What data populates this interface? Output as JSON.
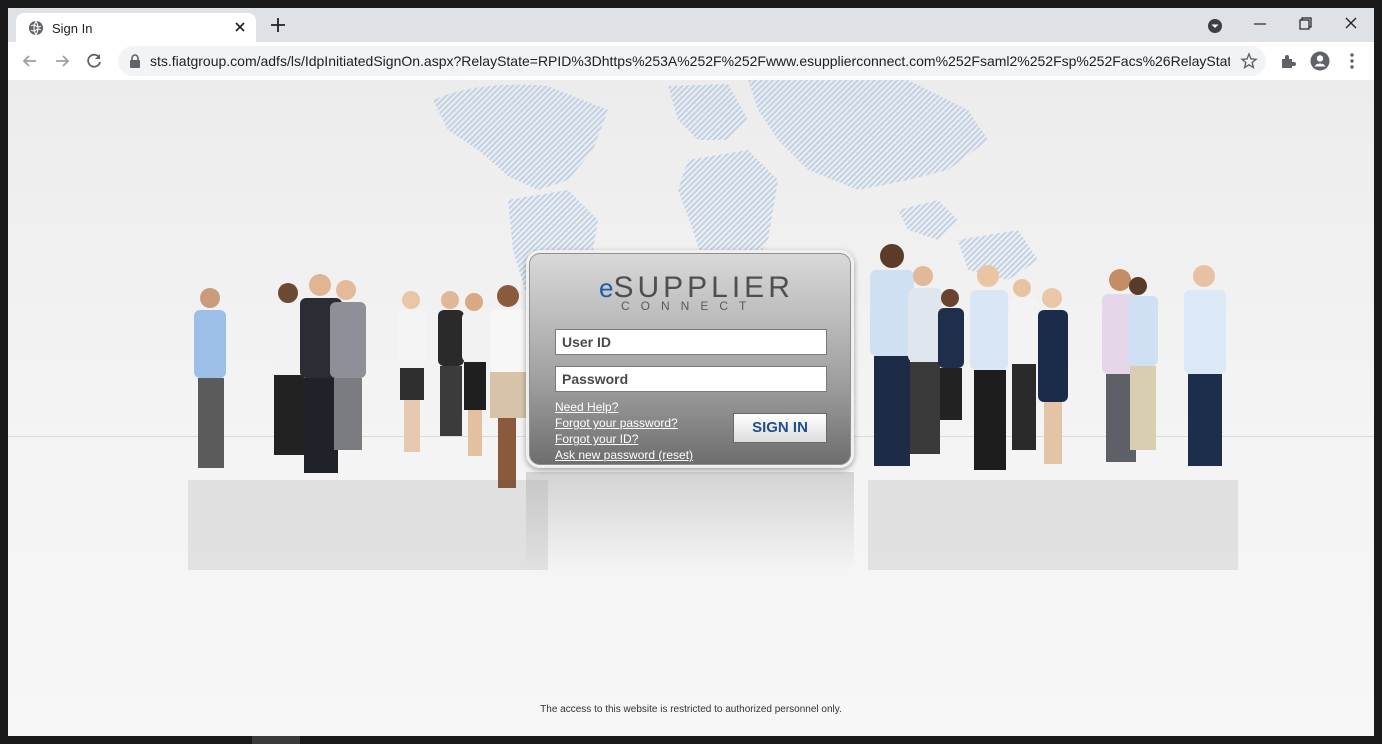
{
  "browser": {
    "tab_title": "Sign In",
    "url": "sts.fiatgroup.com/adfs/ls/IdpInitiatedSignOn.aspx?RelayState=RPID%3Dhttps%253A%252F%252Fwww.esupplierconnect.com%252Fsaml2%252Fsp%252Facs%26RelayState%...",
    "icons": [
      "globe-icon",
      "close-icon",
      "plus-icon",
      "tab-search-icon",
      "minimize-icon",
      "restore-icon",
      "close-window-icon",
      "back-icon",
      "forward-icon",
      "reload-icon",
      "lock-icon",
      "star-icon",
      "extensions-icon",
      "profile-icon",
      "menu-icon"
    ]
  },
  "login": {
    "logo_prefix": "e",
    "logo_main": "SUPPLIER",
    "logo_sub": "CONNECT",
    "user_placeholder": "User ID",
    "password_placeholder": "Password",
    "links": [
      "Need Help?",
      "Forgot your password?",
      "Forgot your ID?",
      "Ask new password (reset)"
    ],
    "signin_label": "SIGN IN"
  },
  "footer": {
    "notice": "The access to this website is restricted to authorized personnel only."
  },
  "colors": {
    "brand_blue": "#1f5aa6",
    "panel_gray": "#9a9a9a",
    "chrome_bar": "#dee1e6"
  }
}
